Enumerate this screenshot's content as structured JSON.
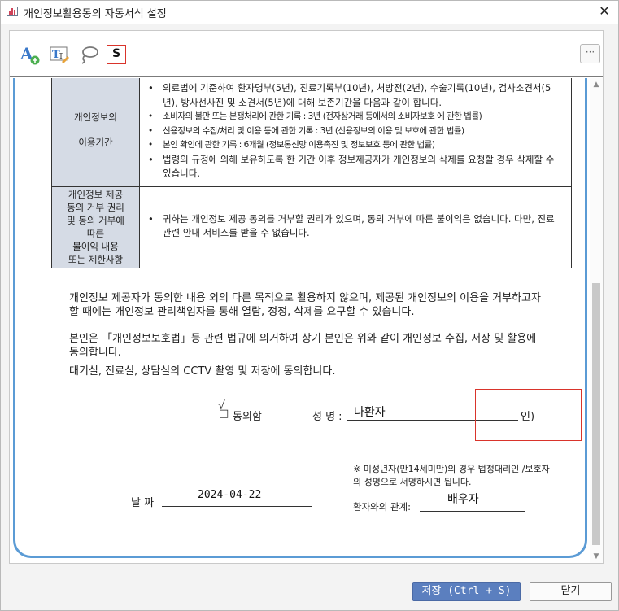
{
  "window": {
    "title": "개인정보활용동의 자동서식 설정",
    "close_glyph": "✕"
  },
  "toolbar": {
    "more_label": "···",
    "sign_label": "S"
  },
  "table": {
    "rows": [
      {
        "head_line1": "개인정보의",
        "head_line2": "이용기간",
        "bullets": [
          "의료법에 기준하여 환자명부(5년), 진료기록부(10년), 처방전(2년), 수술기록(10년), 검사소견서(5년), 방사선사진 및 소견서(5년)에 대해 보존기간을 다음과 같이 합니다.",
          "소비자의 불만 또는 분쟁처리에 관한 기록 : 3년 (전자상거래 등에서의 소비자보호 에 관한 법률)",
          "신용정보의 수집/처리 및 이용 등에 관한 기록 : 3년 (신용정보의 이용 및 보호에 관한 법률)",
          "본인 확인에 관한 기록 : 6개월 (정보통신망 이용촉진 및 정보보호 등에 관한 법률)",
          "법령의 규정에 의해 보유하도록 한 기간 이후 정보제공자가 개인정보의 삭제를 요청할 경우 삭제할 수 있습니다."
        ]
      },
      {
        "head_lines": [
          "개인정보 제공",
          "동의 거부 권리",
          "및 동의 거부에",
          "따른",
          "불이익 내용",
          "또는 제한사항"
        ],
        "bullets": [
          "귀하는 개인정보 제공 동의를 거부할 권리가 있으며, 동의 거부에 따른 불이익은 없습니다. 다만, 진료 관련 안내 서비스를 받을 수 없습니다."
        ]
      }
    ]
  },
  "paragraphs": {
    "p1": "개인정보 제공자가 동의한 내용 외의 다른 목적으로 활용하지 않으며, 제공된 개인정보의 이용을 거부하고자 할 때에는 개인정보 관리책임자를 통해 열람, 정정, 삭제를 요구할 수 있습니다.",
    "p2": "본인은 「개인정보보호법」등 관련 법규에 의거하여 상기 본인은 위와 같이 개인정보 수집, 저장 및 활용에 동의합니다.",
    "p3": "대기실, 진료실, 상담실의 CCTV 촬영 및 저장에 동의합니다."
  },
  "signature": {
    "agree_check": "√",
    "agree_box": "□",
    "agree_label": "동의함",
    "name_label": "성 명 :",
    "name_value": "나환자",
    "seal_label": "인)",
    "minor_note": "※ 미성년자(만14세미만)의  경우 법정대리인 /보호자의 성명으로 서명하시면 됩니다.",
    "date_label": "날 짜",
    "date_value": "2024-04-22",
    "relation_label": "환자와의 관계:",
    "relation_value": "배우자"
  },
  "footer": {
    "save_label": "저장 (Ctrl + S)",
    "close_label": "닫기"
  },
  "colors": {
    "accent": "#5b9bd5",
    "save_button": "#5b7fbf",
    "highlight_box": "#d9342b",
    "table_head": "#d5dbe5"
  }
}
